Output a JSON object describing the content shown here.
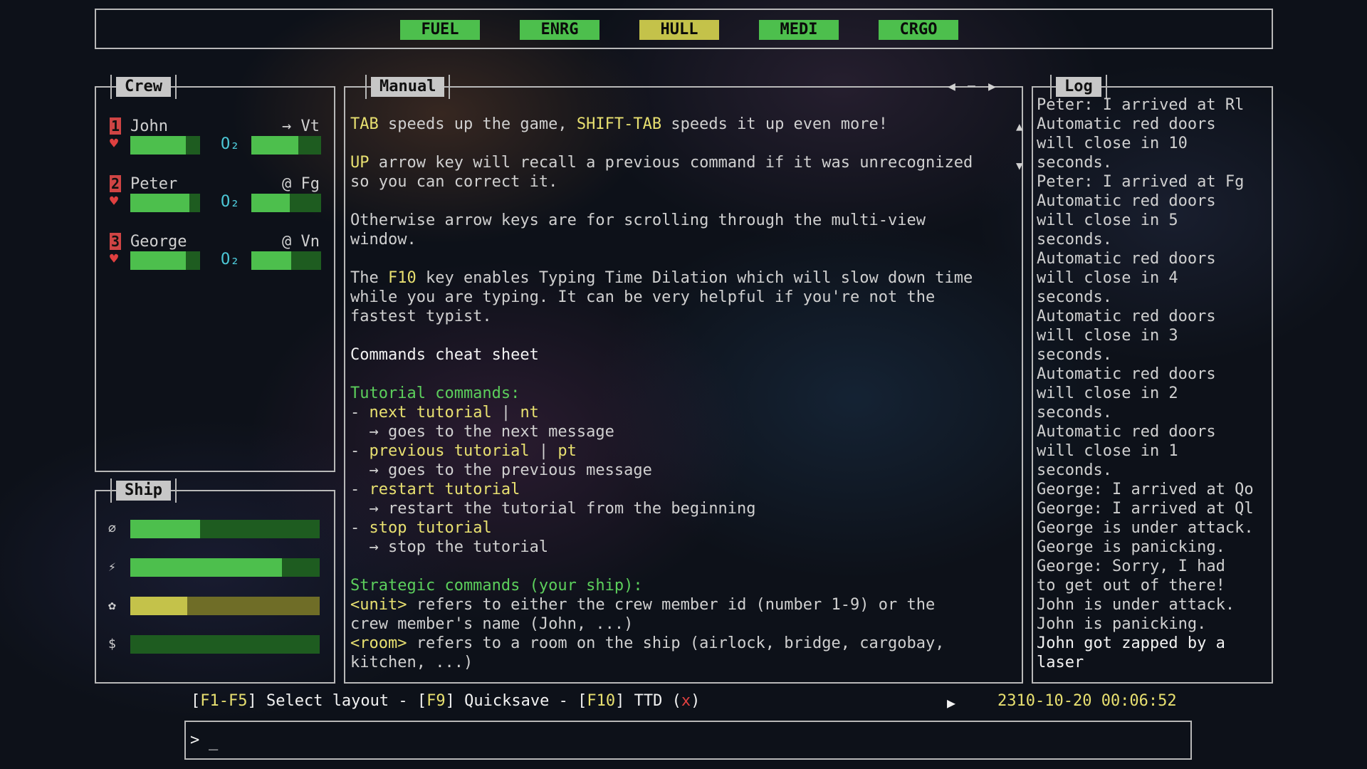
{
  "resources": [
    {
      "label": "FUEL",
      "color": "#4dbf4d"
    },
    {
      "label": "ENRG",
      "color": "#4dbf4d"
    },
    {
      "label": "HULL",
      "color": "#c4c24a"
    },
    {
      "label": "MEDI",
      "color": "#4dbf4d"
    },
    {
      "label": "CRGO",
      "color": "#4dbf4d"
    }
  ],
  "crew_panel": {
    "title": "Crew",
    "members": [
      {
        "id": "1",
        "name": "John",
        "location": "→ Vt",
        "health": 0.8,
        "o2_label": "O₂",
        "o2": 0.67
      },
      {
        "id": "2",
        "name": "Peter",
        "location": "@ Fg",
        "health": 0.85,
        "o2_label": "O₂",
        "o2": 0.55
      },
      {
        "id": "3",
        "name": "George",
        "location": "@ Vn",
        "health": 0.8,
        "o2_label": "O₂",
        "o2": 0.57
      }
    ],
    "health_icon": "♥"
  },
  "ship_panel": {
    "title": "Ship",
    "bars": [
      {
        "icon": "⌀",
        "name": "fuel-icon",
        "level": 0.37,
        "style": "green"
      },
      {
        "icon": "⚡",
        "name": "energy-icon",
        "level": 0.8,
        "style": "green"
      },
      {
        "icon": "✿",
        "name": "hull-icon",
        "level": 0.3,
        "style": "yellow"
      },
      {
        "icon": "$",
        "name": "credits-icon",
        "level": 0.0,
        "style": "green"
      }
    ]
  },
  "manual_panel": {
    "title": "Manual",
    "nav_prev": "◀",
    "nav_dash": "–",
    "nav_next": "▶",
    "scroll_up": "▲",
    "scroll_down": "▼",
    "lines": [
      [
        {
          "t": "TAB",
          "c": "y"
        },
        {
          "t": " speeds up the game, "
        },
        {
          "t": "SHIFT-TAB",
          "c": "y"
        },
        {
          "t": " speeds it up even more!"
        }
      ],
      [],
      [
        {
          "t": "UP",
          "c": "y"
        },
        {
          "t": " arrow key will recall a previous command if it was unrecognized"
        }
      ],
      [
        {
          "t": "so you can correct it."
        }
      ],
      [],
      [
        {
          "t": "Otherwise arrow keys are for scrolling through the multi-view"
        }
      ],
      [
        {
          "t": "window."
        }
      ],
      [],
      [
        {
          "t": "The "
        },
        {
          "t": "F10",
          "c": "y"
        },
        {
          "t": " key enables Typing Time Dilation which will slow down time"
        }
      ],
      [
        {
          "t": "while you are typing. It can be very helpful if you're not the"
        }
      ],
      [
        {
          "t": "fastest typist."
        }
      ],
      [],
      [
        {
          "t": "Commands cheat sheet",
          "c": "w"
        }
      ],
      [],
      [
        {
          "t": "Tutorial commands:",
          "c": "g"
        }
      ],
      [
        {
          "t": "- "
        },
        {
          "t": "next tutorial",
          "c": "y"
        },
        {
          "t": " | "
        },
        {
          "t": "nt",
          "c": "y"
        }
      ],
      [
        {
          "t": "  → goes to the next message"
        }
      ],
      [
        {
          "t": "- "
        },
        {
          "t": "previous tutorial",
          "c": "y"
        },
        {
          "t": " | "
        },
        {
          "t": "pt",
          "c": "y"
        }
      ],
      [
        {
          "t": "  → goes to the previous message"
        }
      ],
      [
        {
          "t": "- "
        },
        {
          "t": "restart tutorial",
          "c": "y"
        }
      ],
      [
        {
          "t": "  → restart the tutorial from the beginning"
        }
      ],
      [
        {
          "t": "- "
        },
        {
          "t": "stop tutorial",
          "c": "y"
        }
      ],
      [
        {
          "t": "  → stop the tutorial"
        }
      ],
      [],
      [
        {
          "t": "Strategic commands (your ship):",
          "c": "g"
        }
      ],
      [
        {
          "t": "<unit>",
          "c": "y"
        },
        {
          "t": " refers to either the crew member id (number 1-9) or the"
        }
      ],
      [
        {
          "t": "crew member's name (John, ...)"
        }
      ],
      [
        {
          "t": "<room>",
          "c": "y"
        },
        {
          "t": " refers to a room on the ship (airlock, bridge, cargobay,"
        }
      ],
      [
        {
          "t": "kitchen, ...)"
        }
      ]
    ]
  },
  "log_panel": {
    "title": "Log",
    "lines": [
      {
        "t": "Peter: I arrived at Rl"
      },
      {
        "t": "Automatic red doors"
      },
      {
        "t": "will close in 10"
      },
      {
        "t": "seconds."
      },
      {
        "t": "Peter: I arrived at Fg"
      },
      {
        "t": "Automatic red doors"
      },
      {
        "t": "will close in 5"
      },
      {
        "t": "seconds."
      },
      {
        "t": "Automatic red doors"
      },
      {
        "t": "will close in 4"
      },
      {
        "t": "seconds."
      },
      {
        "t": "Automatic red doors"
      },
      {
        "t": "will close in 3"
      },
      {
        "t": "seconds."
      },
      {
        "t": "Automatic red doors"
      },
      {
        "t": "will close in 2"
      },
      {
        "t": "seconds."
      },
      {
        "t": "Automatic red doors"
      },
      {
        "t": "will close in 1"
      },
      {
        "t": "seconds."
      },
      {
        "t": "George: I arrived at Qo"
      },
      {
        "t": "George: I arrived at Ql"
      },
      {
        "t": "George is under attack."
      },
      {
        "t": "George is panicking."
      },
      {
        "t": "George: Sorry, I had"
      },
      {
        "t": "to get out of there!"
      },
      {
        "t": "John is under attack."
      },
      {
        "t": "John is panicking."
      },
      {
        "t": "John got zapped by a",
        "c": "w"
      },
      {
        "t": "laser",
        "c": "w"
      }
    ]
  },
  "status_bar": {
    "parts": [
      {
        "t": "[",
        "c": "w"
      },
      {
        "t": "F1-F5",
        "c": "y"
      },
      {
        "t": "] Select layout - [",
        "c": "w"
      },
      {
        "t": "F9",
        "c": "y"
      },
      {
        "t": "] Quicksave - [",
        "c": "w"
      },
      {
        "t": "F10",
        "c": "y"
      },
      {
        "t": "] TTD (",
        "c": "w"
      },
      {
        "t": "x",
        "c": "r"
      },
      {
        "t": ")",
        "c": "w"
      }
    ],
    "play_icon": "▶",
    "datetime": "2310-10-20 00:06:52"
  },
  "command_input": {
    "prompt": ">",
    "cursor": "_"
  }
}
